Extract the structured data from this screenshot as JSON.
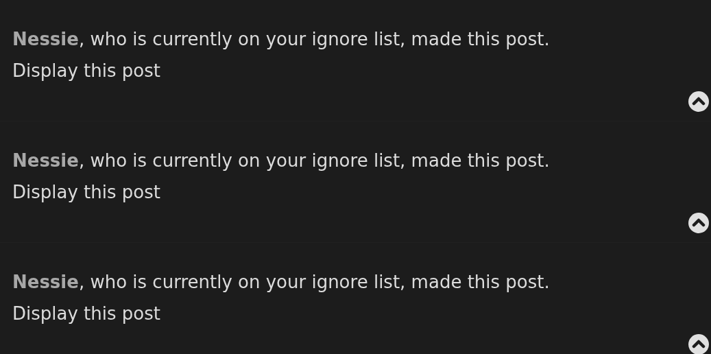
{
  "posts": [
    {
      "notice": "**Nessie**, who is currently on your ignore list, made this post.",
      "link": "Display this post"
    },
    {
      "notice": "**Nessie**, who is currently on your ignore list, made this post.",
      "link": "Display this post"
    },
    {
      "notice": "**Nessie**, who is currently on your ignore list, made this post.",
      "link": "Display this post"
    }
  ]
}
